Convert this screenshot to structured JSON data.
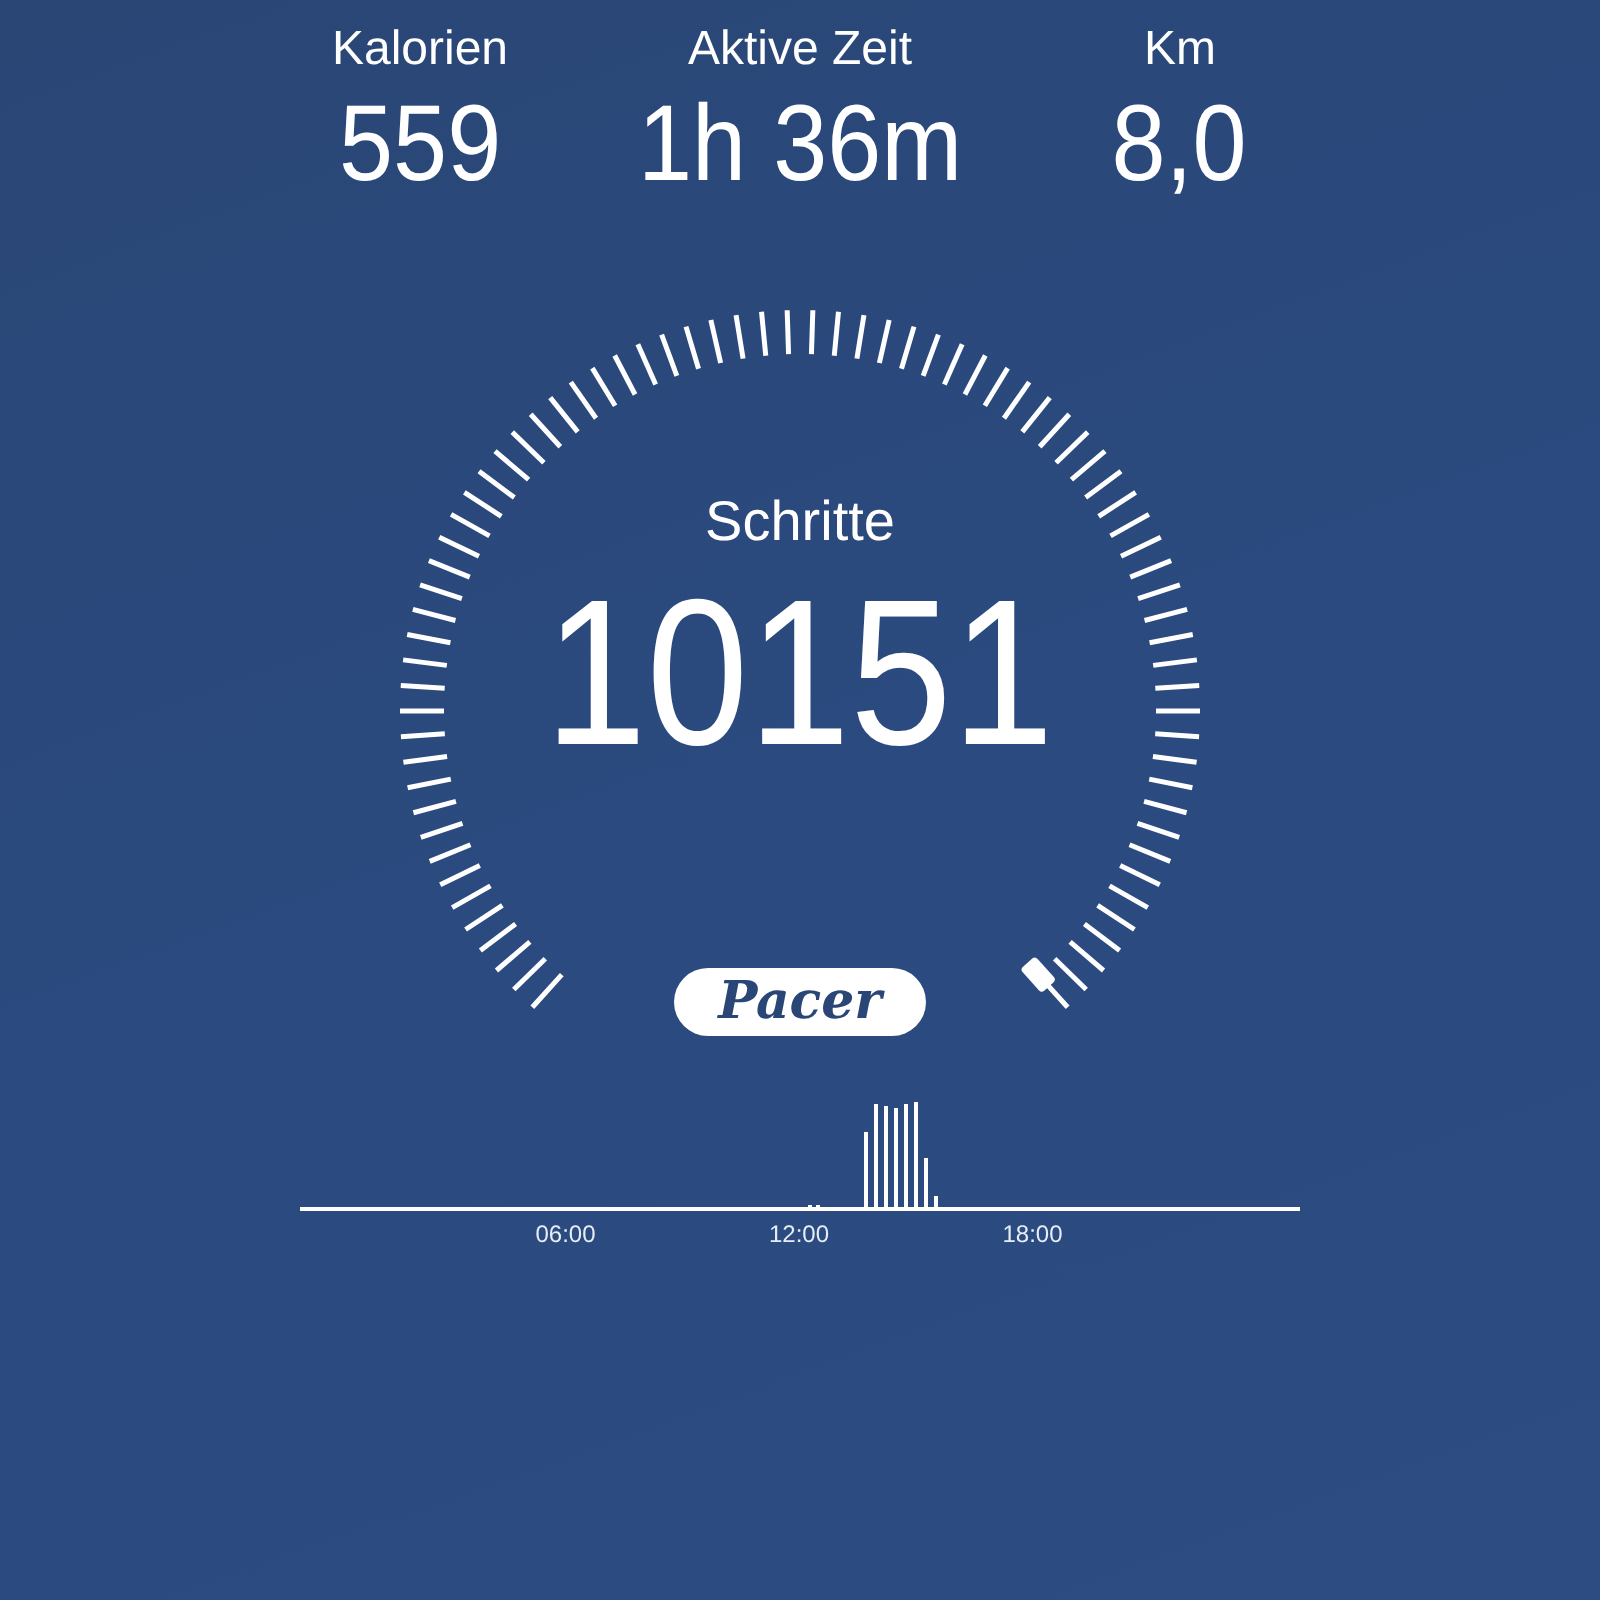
{
  "stats": [
    {
      "label": "Kalorien",
      "value": "559"
    },
    {
      "label": "Aktive Zeit",
      "value": "1h 36m"
    },
    {
      "label": "Km",
      "value": "8,0"
    }
  ],
  "gauge": {
    "label": "Schritte",
    "value": "10151"
  },
  "logo": "Pacer",
  "activity": {
    "hour_labels": [
      "06:00",
      "12:00",
      "18:00"
    ]
  }
}
